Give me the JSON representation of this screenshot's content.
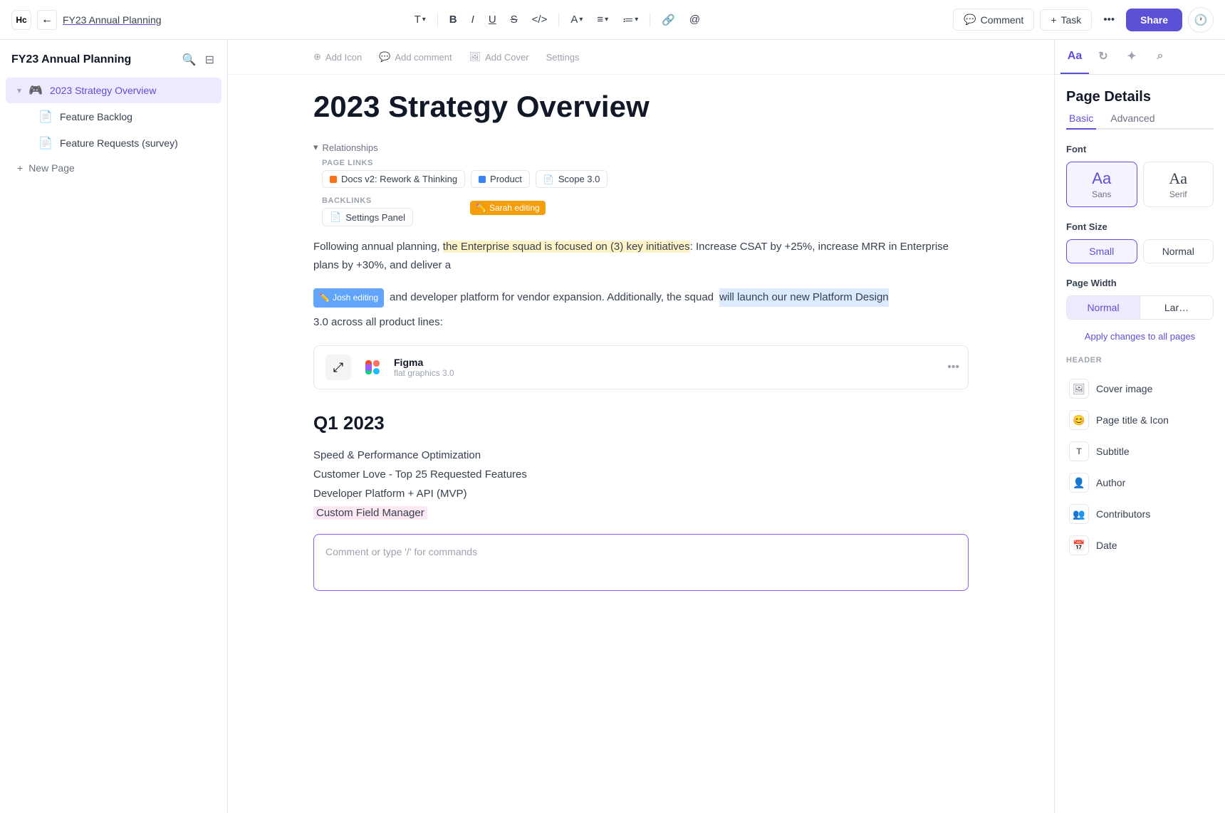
{
  "app": {
    "icon": "Hc",
    "breadcrumb": "FY23 Annual Planning"
  },
  "toolbar": {
    "back_label": "←",
    "format_text": "T",
    "bold": "B",
    "italic": "I",
    "underline": "U",
    "strikethrough": "S",
    "code": "</>",
    "color_label": "A",
    "align_label": "≡",
    "list_label": "≔",
    "link_label": "🔗",
    "mention_label": "@",
    "comment_label": "Comment",
    "task_label": "Task",
    "more_label": "•••",
    "share_label": "Share",
    "history_label": "🕐"
  },
  "sidebar": {
    "workspace_title": "FY23 Annual Planning",
    "items": [
      {
        "id": "strategy",
        "icon": "🎮",
        "label": "2023 Strategy Overview",
        "active": true
      },
      {
        "id": "backlog",
        "icon": "📄",
        "label": "Feature Backlog",
        "active": false
      },
      {
        "id": "requests",
        "icon": "📄",
        "label": "Feature Requests (survey)",
        "active": false
      }
    ],
    "new_page_label": "New Page"
  },
  "page": {
    "meta_add_icon": "Add Icon",
    "meta_add_comment": "Add comment",
    "meta_add_cover": "Add Cover",
    "meta_settings": "Settings",
    "title": "2023 Strategy Overview",
    "relationships_label": "Relationships",
    "page_links_label": "PAGE LINKS",
    "link1_label": "Docs v2: Rework & Thinking",
    "link2_label": "Product",
    "link3_label": "Scope 3.0",
    "backlinks_label": "BACKLINKS",
    "backlink1_label": "Settings Panel",
    "sarah_cursor": "Sarah editing",
    "josh_cursor": "Josh editing",
    "body_text_1_pre": "Following annual planning, ",
    "body_highlight_yellow": "the Enterprise squad is focused on (3) key initiatives",
    "body_text_1_post": ": Increase CSAT by +25%, increase MRR in Enterprise plans by +30%, and deliver a",
    "body_text_2": "and developer platform for vendor expansion. Additionally, the squad",
    "body_highlight_blue": "will launch our new Platform Design",
    "body_text_3": "3.0 across all product lines:",
    "figma_icon_text": "⤢",
    "figma_name": "Figma",
    "figma_sub": "flat graphics 3.0",
    "q1_heading": "Q1 2023",
    "q1_items": [
      "Speed & Performance Optimization",
      "Customer Love - Top 25 Requested Features",
      "Developer Platform + API (MVP)",
      "Custom Field Manager"
    ],
    "comment_placeholder": "Comment or type '/' for commands"
  },
  "right_panel": {
    "tabs": [
      {
        "id": "details",
        "icon": "Aa",
        "active": true
      },
      {
        "id": "refresh",
        "icon": "↻",
        "active": false
      },
      {
        "id": "tools",
        "icon": "✦",
        "active": false
      },
      {
        "id": "search",
        "icon": "⌕",
        "active": false
      }
    ],
    "section_title": "Page Details",
    "sub_tabs": [
      {
        "id": "basic",
        "label": "Basic",
        "active": true
      },
      {
        "id": "advanced",
        "label": "Advanced",
        "active": false
      }
    ],
    "font_label": "Font",
    "font_options": [
      {
        "id": "sans",
        "preview": "Aa",
        "label": "Sans",
        "active": true
      },
      {
        "id": "serif",
        "preview": "Aa",
        "label": "Serif",
        "active": false
      }
    ],
    "font_size_label": "Font Size",
    "font_size_options": [
      {
        "id": "small",
        "label": "Small",
        "active": true
      },
      {
        "id": "normal",
        "label": "Normal",
        "active": false
      }
    ],
    "page_width_label": "Page Width",
    "page_width_options": [
      {
        "id": "normal",
        "label": "Normal",
        "active": true
      },
      {
        "id": "large",
        "label": "Lar…",
        "active": false
      }
    ],
    "apply_changes_label": "Apply changes to all pages",
    "header_section_label": "HEADER",
    "header_options": [
      {
        "id": "cover",
        "icon": "🖼",
        "label": "Cover image"
      },
      {
        "id": "page-title-icon",
        "icon": "😊",
        "label": "Page title & Icon"
      },
      {
        "id": "subtitle",
        "icon": "T",
        "label": "Subtitle"
      },
      {
        "id": "author",
        "icon": "👤",
        "label": "Author"
      },
      {
        "id": "contributors",
        "icon": "👥",
        "label": "Contributors"
      },
      {
        "id": "date",
        "icon": "📅",
        "label": "Date"
      }
    ]
  }
}
